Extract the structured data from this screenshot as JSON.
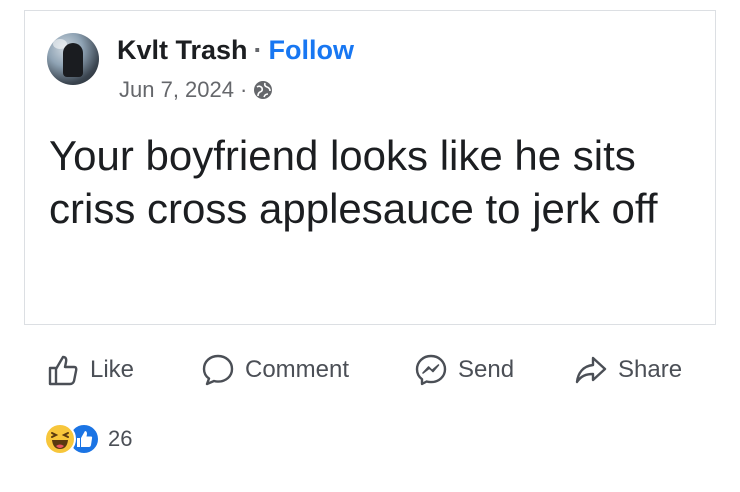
{
  "post": {
    "author": "Kvlt Trash",
    "separator": "·",
    "follow_label": "Follow",
    "date": "Jun 7, 2024",
    "privacy_icon": "globe-icon",
    "text": "Your boyfriend looks like he sits criss cross applesauce to jerk off"
  },
  "actions": {
    "like_label": "Like",
    "comment_label": "Comment",
    "send_label": "Send",
    "share_label": "Share"
  },
  "reactions": {
    "icons": [
      "haha-reaction-icon",
      "like-reaction-icon"
    ],
    "count": "26"
  },
  "colors": {
    "follow": "#1877f2",
    "text": "#1c1e21",
    "muted": "#65676b",
    "like_blue": "#1b74e4",
    "haha_yellow": "#f7c63b"
  }
}
